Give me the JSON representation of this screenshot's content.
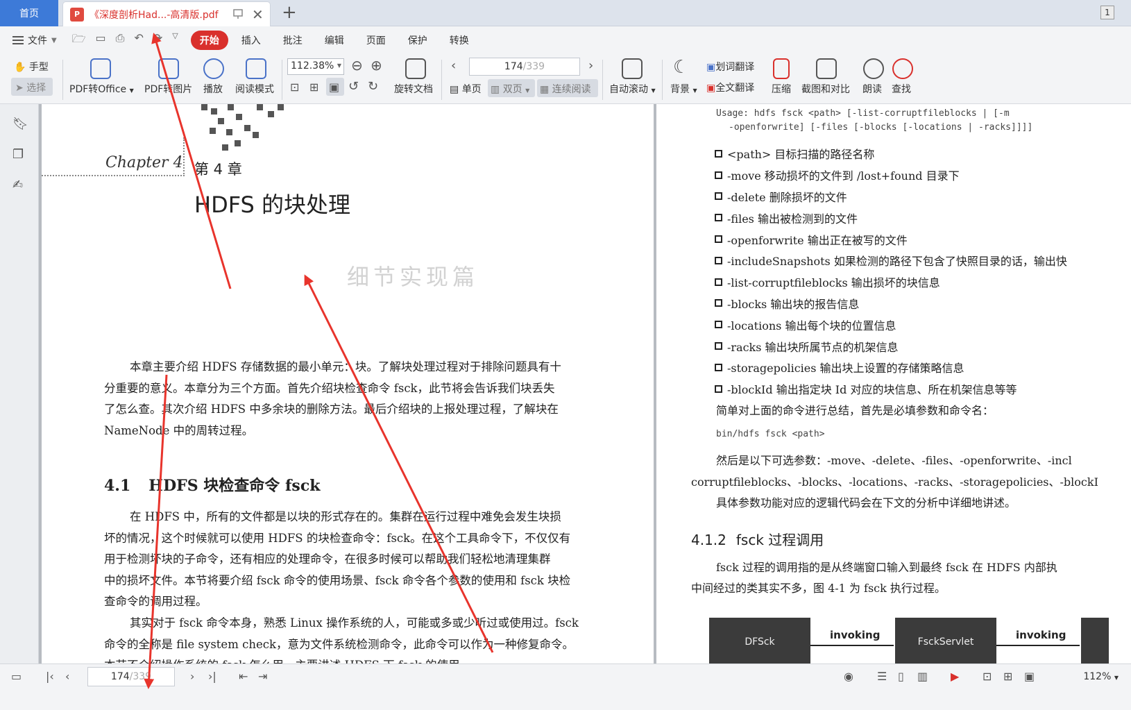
{
  "tabs": {
    "home": "首页",
    "document": "《深度剖析Had...-高清版.pdf",
    "page_badge": "1"
  },
  "menu": {
    "file": "文件",
    "tabs": [
      "开始",
      "插入",
      "批注",
      "编辑",
      "页面",
      "保护",
      "转换"
    ],
    "active_tab": "开始"
  },
  "toolbar": {
    "hand": "手型",
    "select": "选择",
    "pdf_to_office": "PDF转Office",
    "pdf_to_image": "PDF转图片",
    "play": "播放",
    "read_mode": "阅读模式",
    "zoom": "112.38%",
    "rotate_doc": "旋转文档",
    "page_current": "174",
    "page_total": "/339",
    "single_page": "单页",
    "double_page": "双页",
    "continuous": "连续阅读",
    "auto_scroll": "自动滚动",
    "background": "背景",
    "word_translate": "划词翻译",
    "full_translate": "全文翻译",
    "compress": "压缩",
    "screenshot_compare": "截图和对比",
    "read_aloud": "朗读",
    "search": "查找"
  },
  "left_page": {
    "chapter_script": "Chapter 4",
    "chapter_num": "第 4 章",
    "chapter_title": "HDFS 的块处理",
    "ghost_text": "细节实现篇",
    "intro": [
      "本章主要介绍 HDFS 存储数据的最小单元：块。了解块处理过程对于排除问题具有十",
      "分重要的意义。本章分为三个方面。首先介绍块检查命令 fsck，此节将会告诉我们块丢失",
      "了怎么查。其次介绍 HDFS 中多余块的删除方法。最后介绍块的上报处理过程，了解块在",
      "NameNode 中的周转过程。"
    ],
    "section_num": "4.1",
    "section_title": "HDFS 块检查命令 fsck",
    "body1": [
      "在 HDFS 中，所有的文件都是以块的形式存在的。集群在运行过程中难免会发生块损",
      "坏的情况，这个时候就可以使用 HDFS 的块检查命令：fsck。在这个工具命令下，不仅仅有",
      "用于检测坏块的子命令，还有相应的处理命令，在很多时候可以帮助我们轻松地清理集群",
      "中的损坏文件。本节将要介绍 fsck 命令的使用场景、fsck 命令各个参数的使用和 fsck 块检",
      "查命令的调用过程。"
    ],
    "body2": [
      "其实对于 fsck 命令本身，熟悉 Linux 操作系统的人，可能或多或少听过或使用过。fsck",
      "命令的全称是 file system check，意为文件系统检测命令，此命令可以作为一种修复命令。",
      "本节不介绍操作系统的 fsck 怎么用，主要讲述 HDFS 下 fsck 的使用。"
    ]
  },
  "right_page": {
    "usage_line1": "Usage: hdfs fsck <path> [-list-corruptfileblocks | [-m",
    "usage_line2": "-openforwrite] [-files [-blocks [-locations | -racks]]]]",
    "options": [
      "<path> 目标扫描的路径名称",
      "-move 移动损坏的文件到 /lost+found 目录下",
      "-delete 删除损坏的文件",
      "-files 输出被检测到的文件",
      "-openforwrite 输出正在被写的文件",
      "-includeSnapshots 如果检测的路径下包含了快照目录的话，输出快",
      "-list-corruptfileblocks 输出损坏的块信息",
      "-blocks 输出块的报告信息",
      "-locations 输出每个块的位置信息",
      "-racks 输出块所属节点的机架信息",
      "-storagepolicies 输出块上设置的存储策略信息",
      "-blockId 输出指定块 Id 对应的块信息、所在机架信息等等"
    ],
    "summary": "简单对上面的命令进行总结，首先是必填参数和命令名：",
    "cmd": "bin/hdfs fsck <path>",
    "optional1": "然后是以下可选参数：-move、-delete、-files、-openforwrite、-incl",
    "optional2": "corruptfileblocks、-blocks、-locations、-racks、-storagepolicies、-blockI",
    "optional3": "具体参数功能对应的逻辑代码会在下文的分析中详细地讲述。",
    "section_num": "4.1.2",
    "section_title": "fsck 过程调用",
    "para1": "fsck 过程的调用指的是从终端窗口输入到最终 fsck 在 HDFS 内部执",
    "para2": "中间经过的类其实不多，图 4-1 为 fsck 执行过程。",
    "diagram": {
      "box1": "DFSck",
      "arrow1": "invoking",
      "box2": "FsckServlet",
      "arrow2": "invoking"
    }
  },
  "statusbar": {
    "page_current": "174",
    "page_total": "/339",
    "zoom": "112%"
  },
  "colors": {
    "accent_red": "#d9302c",
    "home_tab": "#3d7ad8",
    "annotation_arrow": "#e8342c"
  }
}
